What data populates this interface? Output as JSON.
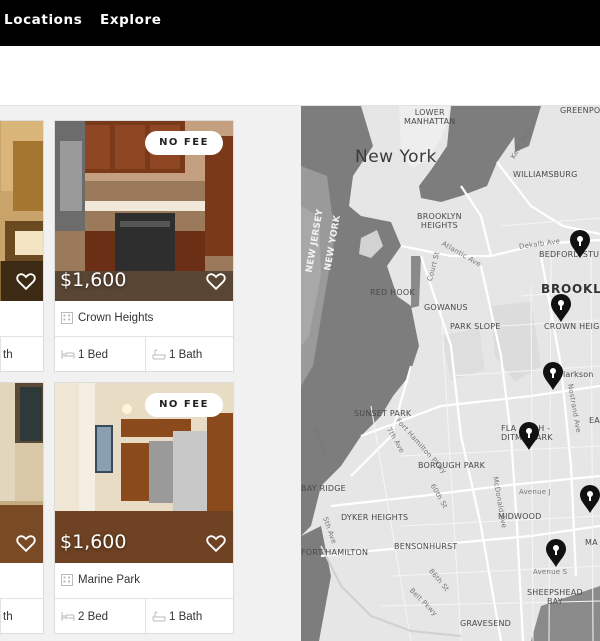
{
  "nav": {
    "links": [
      "Locations",
      "Explore"
    ]
  },
  "listings": [
    {
      "badge": "",
      "price": "",
      "neighborhood": "",
      "beds": "",
      "baths": "th"
    },
    {
      "badge": "NO FEE",
      "price": "$1,600",
      "neighborhood": "Crown Heights",
      "beds": "1 Bed",
      "baths": "1 Bath"
    },
    {
      "badge": "",
      "price": "",
      "neighborhood": "",
      "beds": "",
      "baths": "th"
    },
    {
      "badge": "NO FEE",
      "price": "$1,600",
      "neighborhood": "Marine Park",
      "beds": "2 Bed",
      "baths": "1 Bath"
    }
  ],
  "map": {
    "labels": {
      "lower_manhattan": "LOWER\nMANHATTAN",
      "greenpoint": "GREENPO",
      "new_york": "New York",
      "williamsburg": "WILLIAMSBURG",
      "new_jersey": "NEW JERSEY",
      "new_york_state": "NEW YORK",
      "brooklyn_heights": "BROOKLYN\nHEIGHTS",
      "dekalb": "Dekalb Ave",
      "bedford": "BEDFORD-STU",
      "atlantic": "Atlantic Ave",
      "court_st": "Court St",
      "brooklyn": "BROOKL",
      "red_hook": "RED HOOK",
      "gowanus": "GOWANUS",
      "park_slope": "PARK SLOPE",
      "crown_heights": "CROWN HEIGH",
      "larkson": "larkson",
      "sunset_park": "SUNSET PARK",
      "flatbush": "FLA        H -\nDITM     ARK",
      "nostrand": "Nostrand Ave",
      "ea": "EA",
      "seventh_ave": "7th Ave",
      "fort_hamilton_pkwy": "Fort Hamilton Pkwy",
      "borough_park": "BOROUGH PARK",
      "bay_ridge": "BAY RIDGE",
      "sixtieth": "60th St",
      "mcdonald": "McDonald Ave",
      "avenue_j": "Avenue J",
      "dyker_heights": "DYKER HEIGHTS",
      "midwood": "MIDWOOD",
      "fort_hamilton": "FORT HAMILTON",
      "bensonhurst": "BENSONHURST",
      "ma": "MA",
      "avenue_s": "Avenue S",
      "sheepshead": "SHEEPSHEAD\nBAY",
      "gravesend": "GRAVESEND",
      "eighty_sixth": "86th St",
      "belt_pkwy": "Belt Pkwy",
      "fourth_ave": "4th Ave",
      "fifth_ave": "5th Ave",
      "kent_ave": "Kent Ave"
    }
  },
  "colors": {
    "nav_bg": "#000000",
    "map_land": "#e6e6e6",
    "map_water": "#7a7a7a",
    "pin": "#111111"
  }
}
